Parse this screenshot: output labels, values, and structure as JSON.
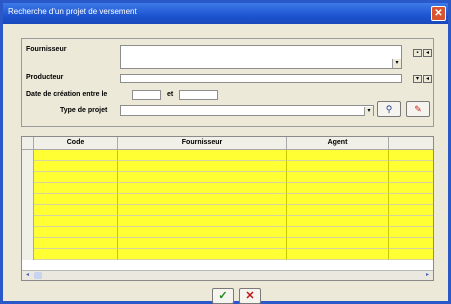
{
  "window": {
    "title": "Recherche d'un projet de versement"
  },
  "form": {
    "fournisseur_label": "Fournisseur",
    "producteur_label": "Producteur",
    "date_label": "Date de création entre le",
    "et_label": "et",
    "type_label": "Type de projet",
    "fournisseur_value": "",
    "producteur_value": "",
    "date_from": "",
    "date_to": "",
    "type_value": ""
  },
  "grid": {
    "columns": [
      "Code",
      "Fournisseur",
      "Agent",
      ""
    ],
    "rows": 10
  },
  "colors": {
    "titlebar": "#1d54d0",
    "row_fill": "#ffff33",
    "confirm": "#1a8a1a",
    "cancel": "#c01818"
  },
  "icons": {
    "search": "binoculars-icon",
    "clear": "eraser-icon",
    "confirm": "checkmark-icon",
    "cancel": "cross-icon"
  }
}
